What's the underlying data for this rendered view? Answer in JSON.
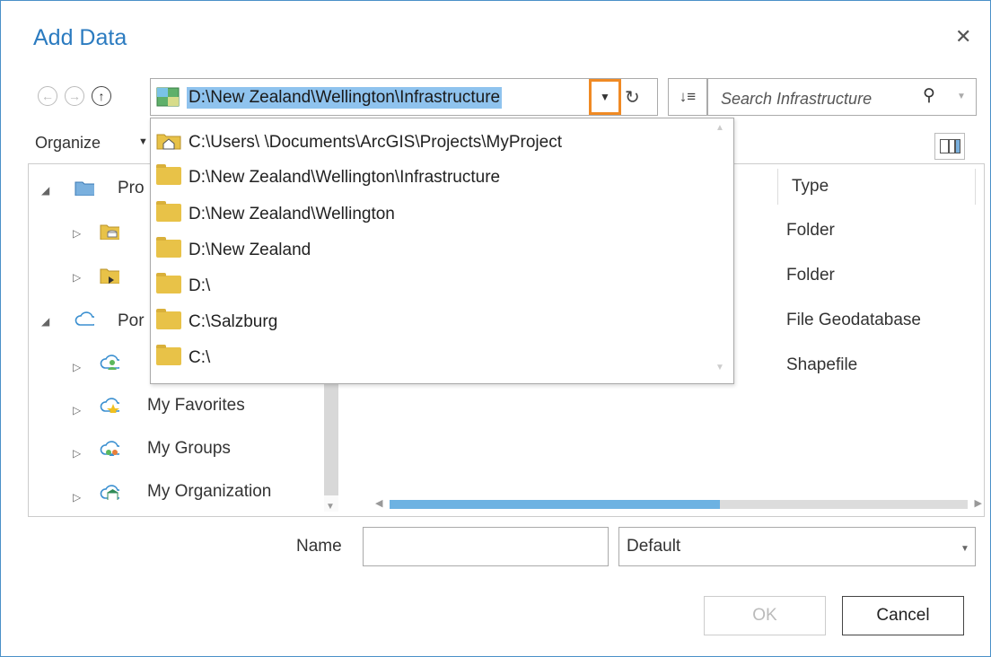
{
  "dialog": {
    "title": "Add Data",
    "close_glyph": "✕"
  },
  "nav": {
    "back_glyph": "←",
    "forward_glyph": "→",
    "up_glyph": "↑"
  },
  "location": {
    "path": "D:\\New Zealand\\Wellington\\Infrastructure",
    "dropdown_glyph": "▼",
    "refresh_glyph": "↻"
  },
  "sort": {
    "glyph": "↓≡"
  },
  "search": {
    "placeholder": "Search Infrastructure",
    "icon_glyph": "⚲",
    "dropdown_glyph": "▼"
  },
  "toolbar": {
    "organize_label": "Organize",
    "organize_arrow": "▼"
  },
  "tree": {
    "items": [
      {
        "label": "Pro",
        "icon": "project-folder-icon",
        "expanded": true
      },
      {
        "label": "",
        "icon": "database-folder-icon",
        "expanded": false
      },
      {
        "label": "",
        "icon": "toolbox-folder-icon",
        "expanded": false
      },
      {
        "label": "Por",
        "icon": "portal-cloud-icon",
        "expanded": true
      },
      {
        "label": "",
        "icon": "my-content-cloud-icon",
        "expanded": false
      },
      {
        "label": "My Favorites",
        "icon": "favorites-cloud-icon",
        "expanded": false
      },
      {
        "label": "My Groups",
        "icon": "groups-cloud-icon",
        "expanded": false
      },
      {
        "label": "My Organization",
        "icon": "organization-cloud-icon",
        "expanded": false
      }
    ]
  },
  "content": {
    "type_header": "Type",
    "types": [
      "Folder",
      "Folder",
      "File Geodatabase",
      "Shapefile"
    ]
  },
  "recent_locations": [
    {
      "path": "C:\\Users\\        \\Documents\\ArcGIS\\Projects\\MyProject",
      "icon": "home-folder-icon"
    },
    {
      "path": "D:\\New Zealand\\Wellington\\Infrastructure",
      "icon": "folder-icon"
    },
    {
      "path": "D:\\New Zealand\\Wellington",
      "icon": "folder-icon"
    },
    {
      "path": "D:\\New Zealand",
      "icon": "folder-icon"
    },
    {
      "path": "D:\\",
      "icon": "folder-icon"
    },
    {
      "path": "C:\\Salzburg",
      "icon": "folder-icon"
    },
    {
      "path": "C:\\",
      "icon": "folder-icon"
    }
  ],
  "footer": {
    "name_label": "Name",
    "name_value": "",
    "filter_value": "Default",
    "filter_arrow": "▼",
    "ok_label": "OK",
    "cancel_label": "Cancel"
  },
  "colors": {
    "accent": "#2b7bc0",
    "highlight": "#f08a24",
    "selection": "#8fc3ee",
    "folder": "#e8c248"
  }
}
